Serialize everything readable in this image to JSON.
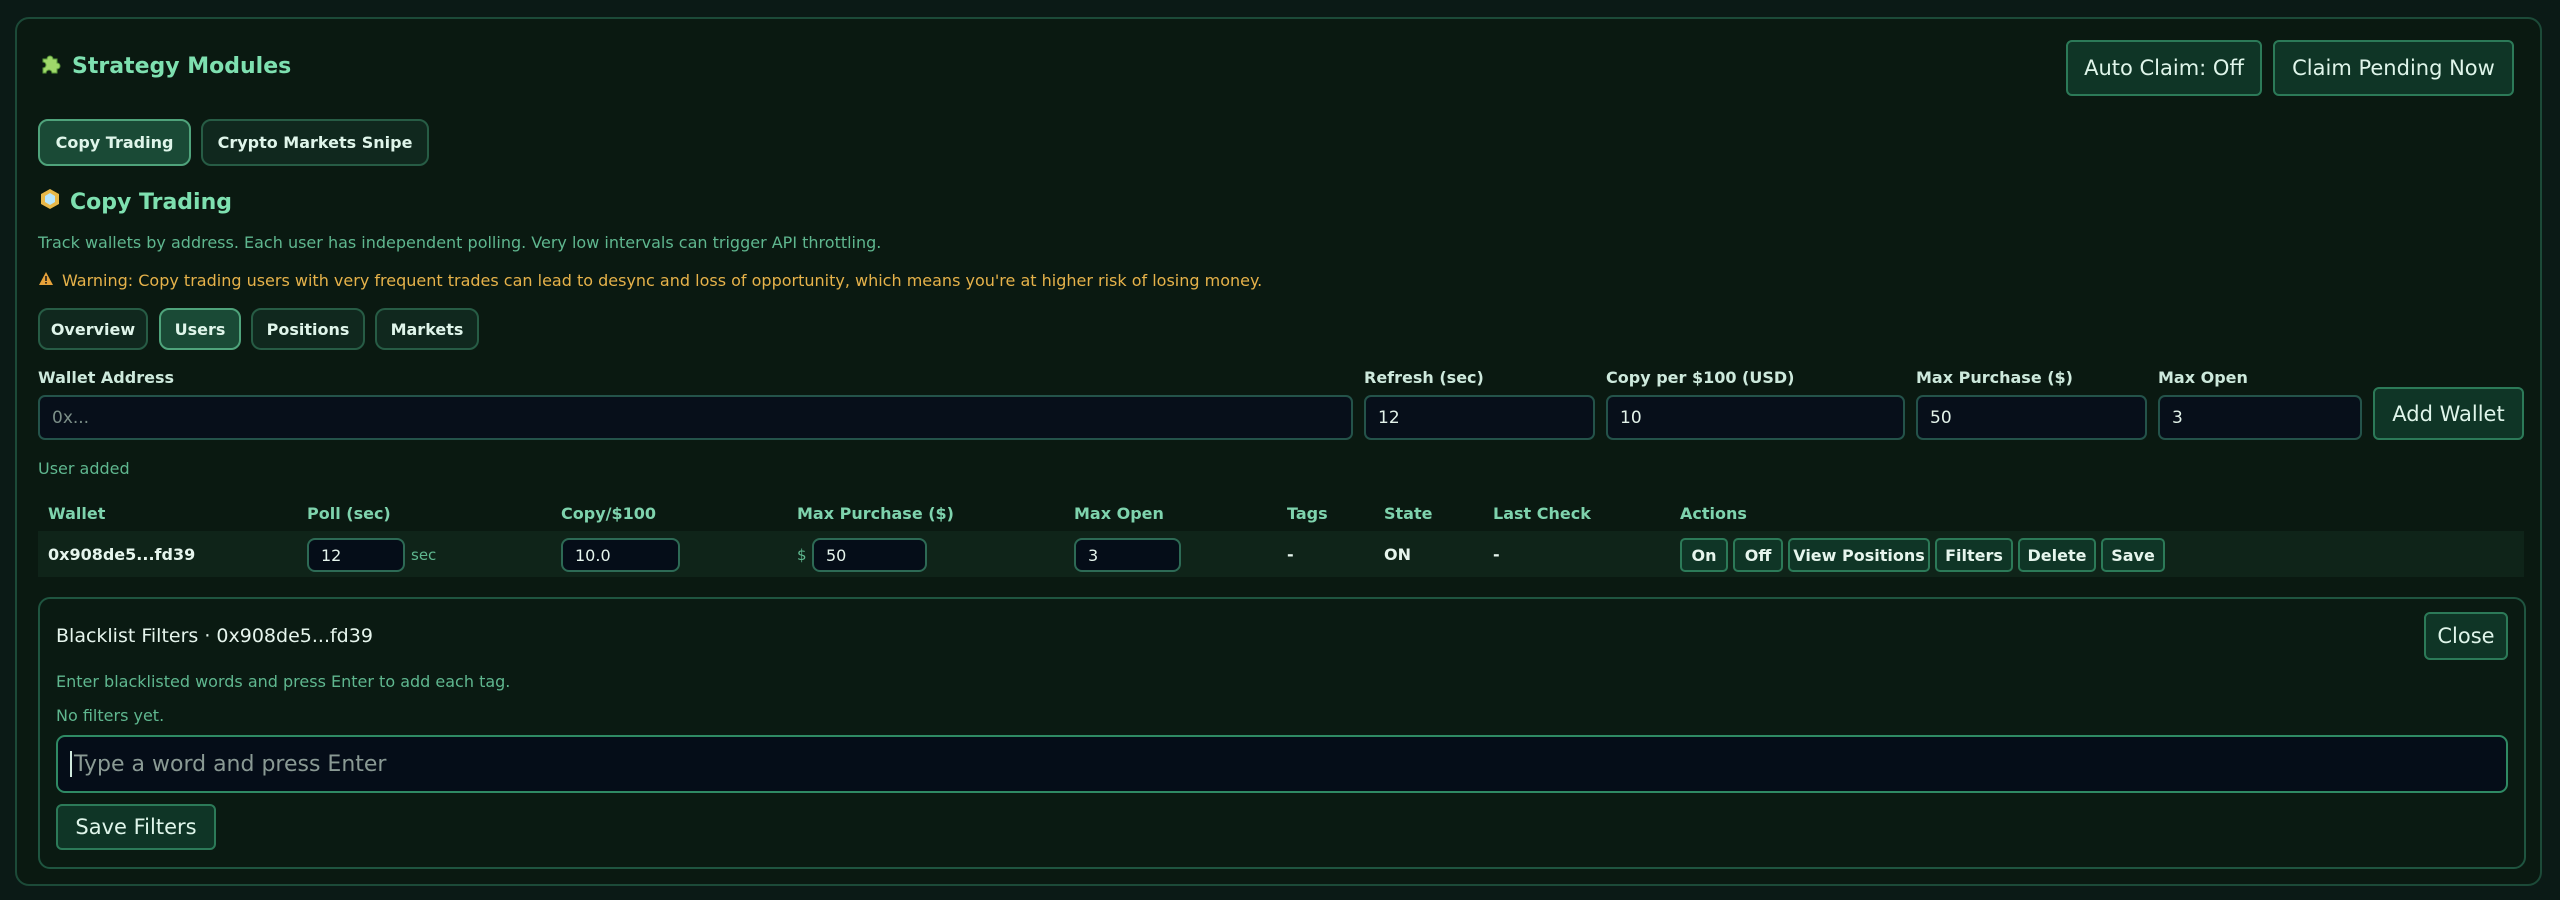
{
  "header": {
    "icon": "puzzle-icon",
    "title": "Strategy Modules",
    "auto_claim_label": "Auto Claim: Off",
    "claim_pending_label": "Claim Pending Now"
  },
  "modules": {
    "tabs": [
      {
        "label": "Copy Trading",
        "active": true
      },
      {
        "label": "Crypto Markets Snipe",
        "active": false
      }
    ]
  },
  "copy_trading": {
    "icon": "hexagon-icon",
    "title": "Copy Trading",
    "description": "Track wallets by address. Each user has independent polling. Very low intervals can trigger API throttling.",
    "warning": "Warning: Copy trading users with very frequent trades can lead to desync and loss of opportunity, which means you're at higher risk of losing money.",
    "subtabs": [
      {
        "label": "Overview",
        "active": false
      },
      {
        "label": "Users",
        "active": true
      },
      {
        "label": "Positions",
        "active": false
      },
      {
        "label": "Markets",
        "active": false
      }
    ]
  },
  "add_form": {
    "wallet_label": "Wallet Address",
    "wallet_placeholder": "0x...",
    "refresh_label": "Refresh (sec)",
    "refresh_value": "12",
    "copy_label": "Copy per $100 (USD)",
    "copy_value": "10",
    "max_purchase_label": "Max Purchase ($)",
    "max_purchase_value": "50",
    "max_open_label": "Max Open",
    "max_open_value": "3",
    "add_button": "Add Wallet",
    "status": "User added"
  },
  "table": {
    "headers": [
      "Wallet",
      "Poll (sec)",
      "Copy/$100",
      "Max Purchase ($)",
      "Max Open",
      "Tags",
      "State",
      "Last Check",
      "Actions"
    ],
    "rows": [
      {
        "wallet": "0x908de5...fd39",
        "poll": "12",
        "poll_unit": "sec",
        "copy": "10.0",
        "currency": "$",
        "max_purchase": "50",
        "max_open": "3",
        "tags": "-",
        "state": "ON",
        "last_check": "-",
        "actions": {
          "on": "On",
          "off": "Off",
          "view": "View Positions",
          "filters": "Filters",
          "delete": "Delete",
          "save": "Save"
        }
      }
    ]
  },
  "blacklist": {
    "title": "Blacklist Filters · 0x908de5...fd39",
    "close_label": "Close",
    "hint": "Enter blacklisted words and press Enter to add each tag.",
    "empty": "No filters yet.",
    "input_placeholder": "Type a word and press Enter",
    "save_label": "Save Filters"
  }
}
